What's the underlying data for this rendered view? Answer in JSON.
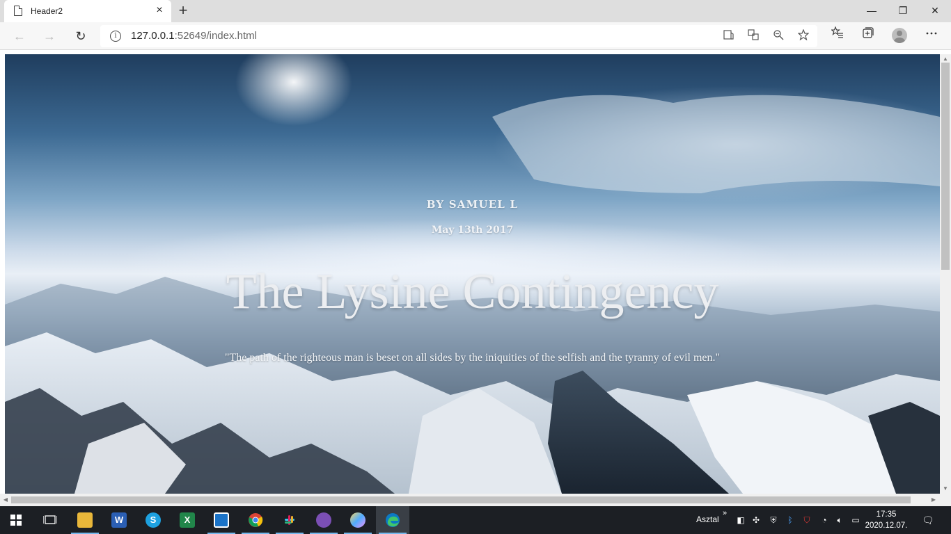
{
  "browser": {
    "tab_title": "Header2",
    "tab_close": "×",
    "new_tab": "+",
    "url_host": "127.0.0.1",
    "url_rest": ":52649/index.html",
    "window_controls": {
      "minimize": "—",
      "restore": "❐",
      "close": "✕"
    },
    "nav": {
      "back": "←",
      "forward": "→",
      "reload": "↻"
    },
    "info_glyph": "i",
    "icons": [
      "reader-view-icon",
      "translate-icon",
      "zoom-icon",
      "favorite-star-icon",
      "favorites-list-icon",
      "collections-icon",
      "profile-avatar-icon",
      "more-icon"
    ]
  },
  "hero": {
    "byline": "BY SAMUEL L",
    "date": "May 13th 2017",
    "title": "The Lysine Contingency",
    "quote": "\"The path of the righteous man is beset on all sides by the iniquities of the selfish and the tyranny of evil men.\""
  },
  "taskbar": {
    "desktop_label": "Asztal",
    "overflow": "»",
    "time": "17:35",
    "date": "2020.12.07.",
    "apps": [
      "file-explorer",
      "word",
      "skype",
      "excel",
      "notepad",
      "chrome",
      "slack",
      "github-desktop",
      "paint",
      "edge"
    ]
  }
}
